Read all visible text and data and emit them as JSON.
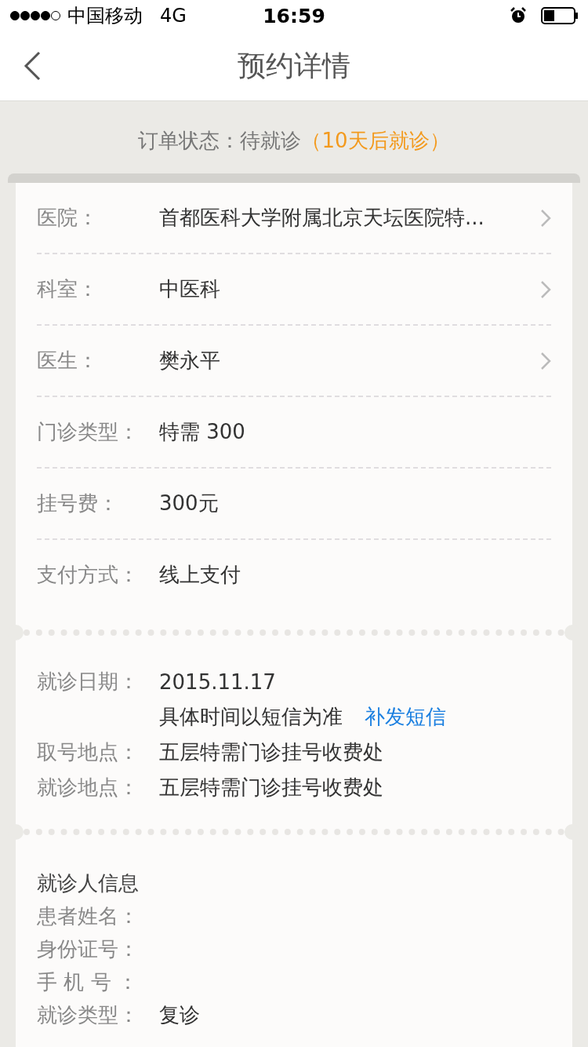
{
  "status_bar": {
    "carrier": "中国移动",
    "network": "4G",
    "time": "16:59"
  },
  "nav": {
    "title": "预约详情"
  },
  "order_status": {
    "label": "订单状态：待就诊",
    "note": "（10天后就诊）"
  },
  "details": [
    {
      "label": "医院：",
      "value": "首都医科大学附属北京天坛医院特...",
      "chevron": true
    },
    {
      "label": "科室：",
      "value": "中医科",
      "chevron": true
    },
    {
      "label": "医生：",
      "value": "樊永平",
      "chevron": true
    },
    {
      "label": "门诊类型：",
      "value": "特需 300",
      "chevron": false
    },
    {
      "label": "挂号费：",
      "value": "300元",
      "chevron": false
    },
    {
      "label": "支付方式：",
      "value": "线上支付",
      "chevron": false
    }
  ],
  "visit": [
    {
      "label": "就诊日期：",
      "value": "2015.11.17"
    },
    {
      "value": "具体时间以短信为准",
      "link": "补发短信"
    },
    {
      "label": "取号地点：",
      "value": "五层特需门诊挂号收费处"
    },
    {
      "label": "就诊地点：",
      "value": "五层特需门诊挂号收费处"
    }
  ],
  "patient": {
    "title": "就诊人信息",
    "rows": [
      {
        "label": "患者姓名："
      },
      {
        "label": "身份证号："
      },
      {
        "label": "手 机 号 ："
      },
      {
        "label": "就诊类型：",
        "value": "复诊"
      }
    ]
  }
}
